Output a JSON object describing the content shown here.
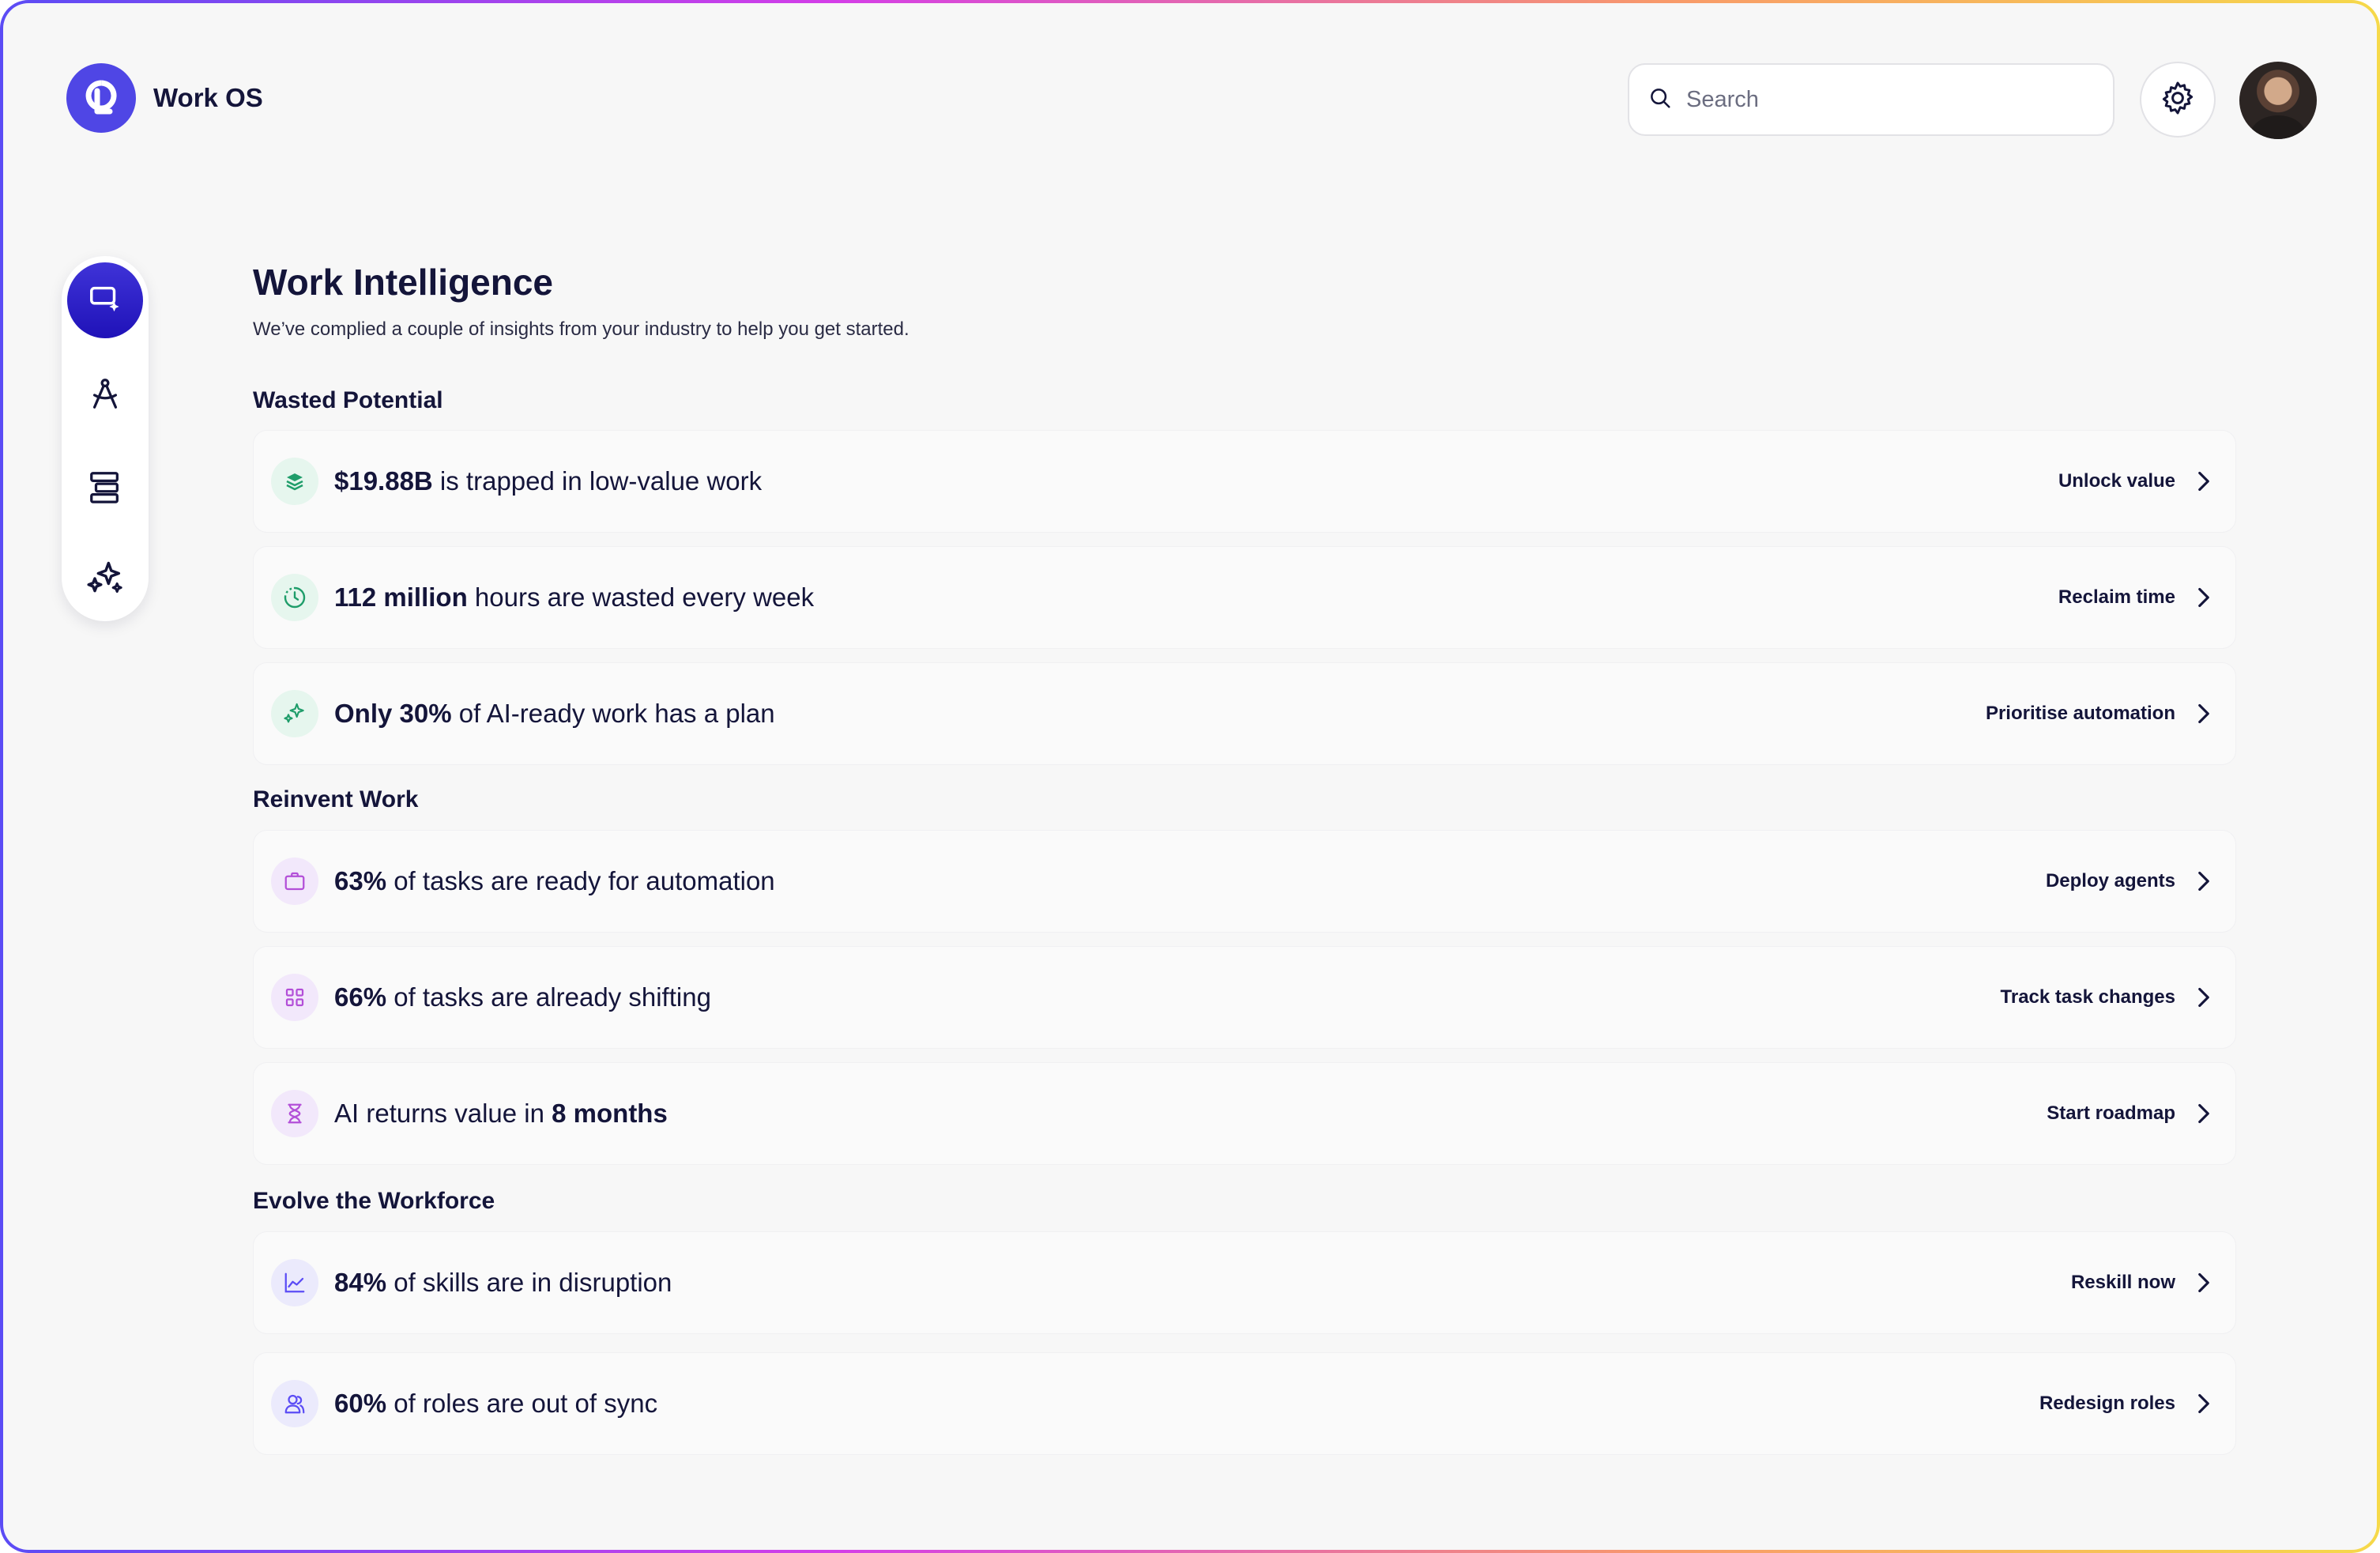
{
  "header": {
    "brand": "Work OS",
    "search_placeholder": "Search"
  },
  "icons": {
    "logo": "logo-icon",
    "search": "search-icon",
    "settings": "gear-icon",
    "avatar": "user-avatar"
  },
  "sidebar": {
    "items": [
      {
        "name": "work-intelligence",
        "icon": "screen-sparkle-icon",
        "active": true
      },
      {
        "name": "compass",
        "icon": "compass-icon",
        "active": false
      },
      {
        "name": "org-structure",
        "icon": "stacked-blocks-icon",
        "active": false
      },
      {
        "name": "ai-sparkles",
        "icon": "sparkles-icon",
        "active": false
      }
    ]
  },
  "main": {
    "title": "Work Intelligence",
    "subtitle": "We’ve complied a couple of insights from your industry to help you get started."
  },
  "sections": [
    {
      "title": "Wasted Potential",
      "cards": [
        {
          "bold": "$19.88B",
          "rest": " is trapped in low-value work",
          "action": "Unlock value",
          "icon": "layers-icon",
          "tone": "green"
        },
        {
          "bold": "112 million",
          "rest": " hours are wasted every week",
          "action": "Reclaim time",
          "icon": "clock-icon",
          "tone": "green"
        },
        {
          "bold": "Only 30%",
          "rest": " of AI-ready work has a plan",
          "action": "Prioritise automation",
          "icon": "sparkles-icon",
          "tone": "green"
        }
      ]
    },
    {
      "title": "Reinvent Work",
      "cards": [
        {
          "bold": "63%",
          "rest": " of tasks are ready for automation",
          "action": "Deploy agents",
          "icon": "briefcase-icon",
          "tone": "purple"
        },
        {
          "bold": "66%",
          "rest": " of tasks are already shifting",
          "action": "Track task changes",
          "icon": "grid-icon",
          "tone": "purple"
        },
        {
          "pre": "AI returns value in ",
          "bold": "8 months",
          "action": "Start roadmap",
          "icon": "hourglass-icon",
          "tone": "purple"
        }
      ]
    },
    {
      "title": "Evolve the Workforce",
      "cards": [
        {
          "bold": "84%",
          "rest": " of skills are in disruption",
          "action": "Reskill now",
          "icon": "chart-icon",
          "tone": "indigo"
        },
        {
          "bold": "60%",
          "rest": " of roles are out of sync",
          "action": "Redesign roles",
          "icon": "users-icon",
          "tone": "indigo"
        }
      ]
    }
  ]
}
